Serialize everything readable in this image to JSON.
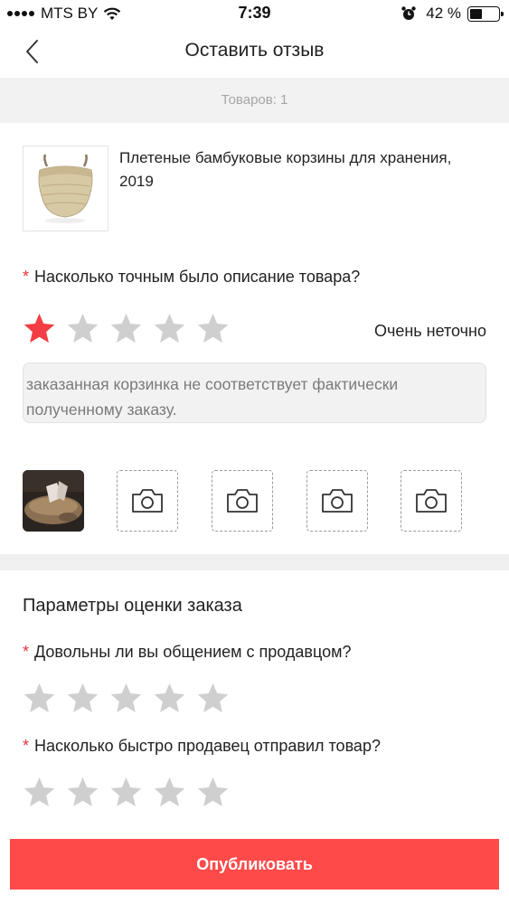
{
  "status_bar": {
    "carrier": "MTS BY",
    "time": "7:39",
    "battery": "42 %",
    "battery_level": 0.42
  },
  "nav": {
    "title": "Оставить отзыв",
    "back_icon": "chevron-left-icon"
  },
  "goods_count": "Товаров: 1",
  "product": {
    "title": "Плетеные бамбуковые корзины для хранения, 2019"
  },
  "description_rating": {
    "required_mark": "*",
    "question": "Насколько точным было описание товара?",
    "rating": 1,
    "max": 5,
    "label": "Очень неточно"
  },
  "review": {
    "text": "заказанная корзинка не соответствует фактически полученному заказу."
  },
  "photos": {
    "uploaded": 1,
    "empty_slots": 4,
    "slot_icon": "camera-icon"
  },
  "order_rating": {
    "section_title": "Параметры оценки заказа",
    "questions": [
      {
        "required_mark": "*",
        "text": "Довольны ли вы общением с продавцом?",
        "rating": 0
      },
      {
        "required_mark": "*",
        "text": "Насколько быстро продавец отправил товар?",
        "rating": 0
      }
    ]
  },
  "publish_button": "Опубликовать",
  "colors": {
    "accent": "#ff4a4a",
    "star_active": "#f23d45",
    "star_inactive": "#cfcfcf"
  }
}
